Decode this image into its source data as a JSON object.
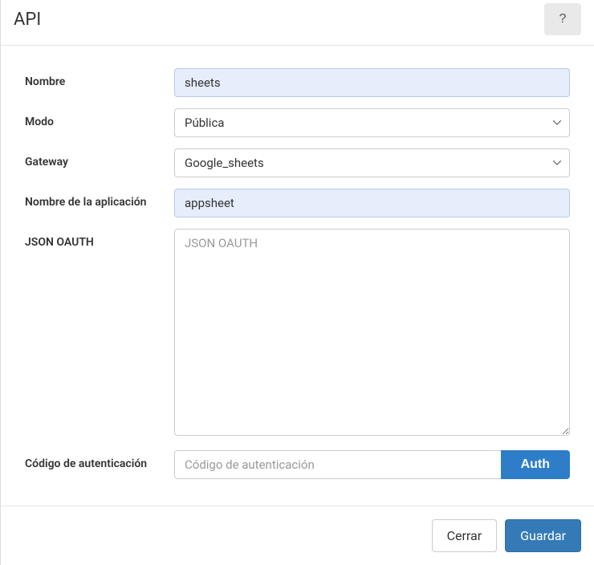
{
  "header": {
    "title": "API",
    "help": "?"
  },
  "fields": {
    "name": {
      "label": "Nombre",
      "value": "sheets"
    },
    "mode": {
      "label": "Modo",
      "value": "Pública"
    },
    "gateway": {
      "label": "Gateway",
      "value": "Google_sheets"
    },
    "appname": {
      "label": "Nombre de la aplicación",
      "value": "appsheet"
    },
    "json_oauth": {
      "label": "JSON OAUTH",
      "placeholder": "JSON OAUTH",
      "value": ""
    },
    "auth_code": {
      "label": "Código de autenticación",
      "placeholder": "Código de autenticación",
      "value": "",
      "button": "Auth"
    }
  },
  "footer": {
    "close": "Cerrar",
    "save": "Guardar"
  }
}
